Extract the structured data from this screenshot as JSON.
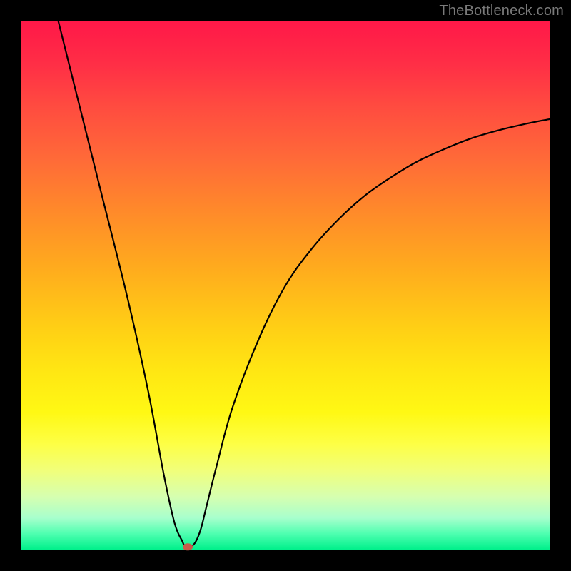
{
  "attribution": "TheBottleneck.com",
  "chart_data": {
    "type": "line",
    "title": "",
    "xlabel": "",
    "ylabel": "",
    "xlim": [
      0,
      100
    ],
    "ylim": [
      0,
      100
    ],
    "grid": false,
    "legend": false,
    "series": [
      {
        "name": "curve",
        "x": [
          7,
          10,
          15,
          20,
          24,
          27,
          29,
          30.5,
          31,
          32,
          33,
          34,
          35,
          37,
          40,
          45,
          50,
          55,
          60,
          65,
          70,
          75,
          80,
          85,
          90,
          95,
          100
        ],
        "values": [
          100,
          88,
          68,
          48,
          30,
          14,
          5,
          1.5,
          0.5,
          0.5,
          1.5,
          4,
          8,
          16,
          27,
          40,
          50,
          57,
          62.5,
          67,
          70.5,
          73.5,
          75.8,
          77.8,
          79.3,
          80.5,
          81.5
        ]
      }
    ],
    "marker": {
      "x": 31.5,
      "y": 0.5,
      "color": "#c95a4a"
    },
    "gradient_stops": [
      {
        "pos": 0,
        "color": "#ff1848"
      },
      {
        "pos": 8,
        "color": "#ff2e46"
      },
      {
        "pos": 16,
        "color": "#ff4b40"
      },
      {
        "pos": 26,
        "color": "#ff6a38"
      },
      {
        "pos": 36,
        "color": "#ff8a2a"
      },
      {
        "pos": 46,
        "color": "#ffa91e"
      },
      {
        "pos": 58,
        "color": "#ffcf15"
      },
      {
        "pos": 66,
        "color": "#ffe613"
      },
      {
        "pos": 74,
        "color": "#fff814"
      },
      {
        "pos": 80,
        "color": "#fdff45"
      },
      {
        "pos": 85,
        "color": "#f1ff7a"
      },
      {
        "pos": 90,
        "color": "#d6ffb0"
      },
      {
        "pos": 94,
        "color": "#a8ffcd"
      },
      {
        "pos": 97,
        "color": "#4effb0"
      },
      {
        "pos": 100,
        "color": "#00f08b"
      }
    ]
  }
}
